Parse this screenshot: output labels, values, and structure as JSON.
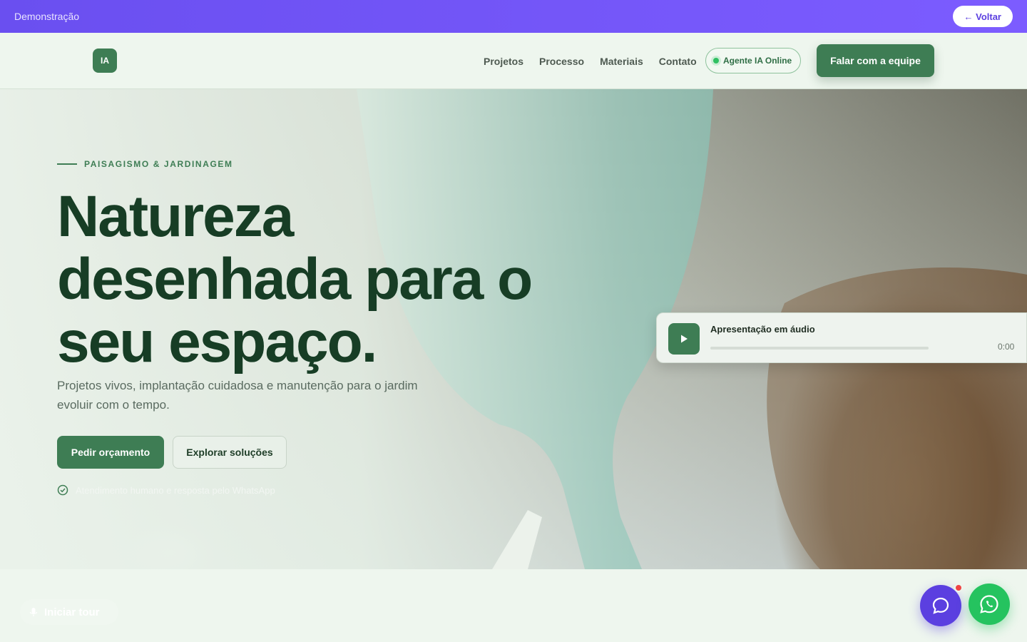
{
  "demo_bar": {
    "label": "Demonstração",
    "back_label": "← Voltar"
  },
  "header": {
    "logo_text": "IA",
    "nav": [
      "Projetos",
      "Processo",
      "Materiais",
      "Contato"
    ],
    "agent_status": "Agente IA Online",
    "cta_label": "Falar com a equipe"
  },
  "hero": {
    "eyebrow": "PAISAGISMO & JARDINAGEM",
    "headline": "Natureza desenhada para o seu espaço.",
    "subtitle": "Projetos vivos, implantação cuidadosa e manutenção para o jardim evoluir com o tempo.",
    "primary_button": "Pedir orçamento",
    "secondary_button": "Explorar soluções",
    "note": "Atendimento humano e resposta pelo WhatsApp"
  },
  "audio": {
    "title": "Apresentação em áudio",
    "time": "0:00",
    "progress": 0
  },
  "tour": {
    "label": "Iniciar tour"
  },
  "colors": {
    "brand": "#3e7d54",
    "demo_bar": "#6a4ff0",
    "chat": "#5b3fe0",
    "whatsapp": "#25c35f"
  }
}
